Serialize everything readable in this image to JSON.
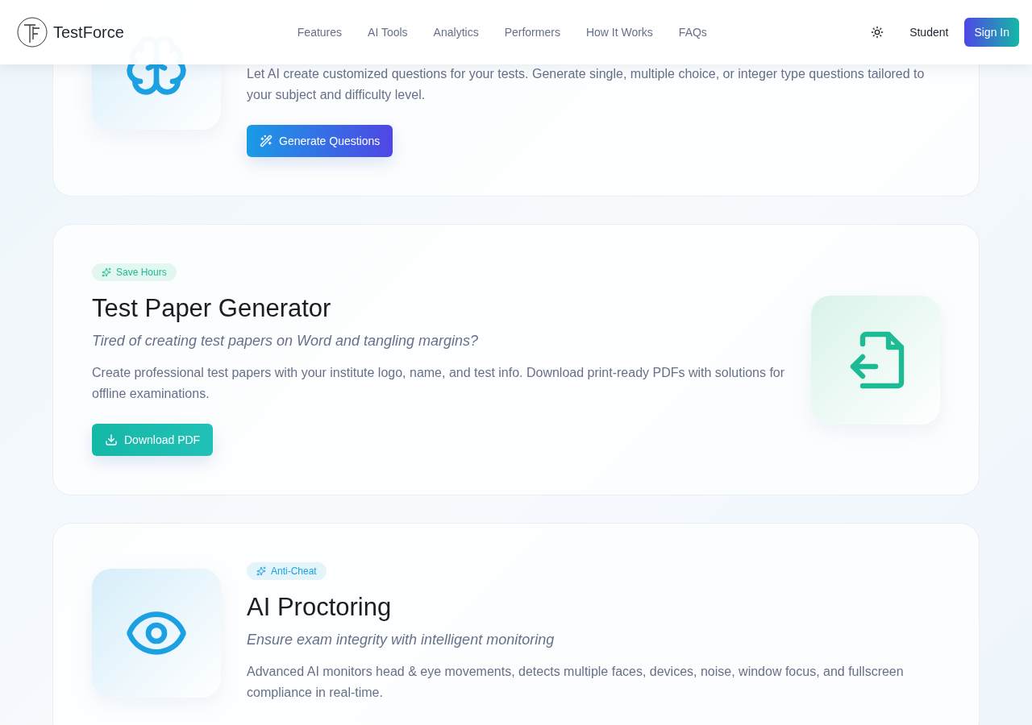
{
  "header": {
    "brand": "TestForce",
    "nav": [
      {
        "label": "Features"
      },
      {
        "label": "AI Tools"
      },
      {
        "label": "Analytics"
      },
      {
        "label": "Performers"
      },
      {
        "label": "How It Works"
      },
      {
        "label": "FAQs"
      }
    ],
    "role_link": "Student",
    "sign_in": "Sign In"
  },
  "features": [
    {
      "kind": "icon-left",
      "description": "Let AI create customized questions for your tests. Generate single, multiple choice, or integer type questions tailored to your subject and difficulty level.",
      "button": "Generate Questions"
    },
    {
      "kind": "icon-right",
      "badge": "Save Hours",
      "title": "Test Paper Generator",
      "subtitle": "Tired of creating test papers on Word and tangling margins?",
      "description": "Create professional test papers with your institute logo, name, and test info. Download print-ready PDFs with solutions for offline examinations.",
      "button": "Download PDF"
    },
    {
      "kind": "icon-left",
      "badge": "Anti-Cheat",
      "title": "AI Proctoring",
      "subtitle": "Ensure exam integrity with intelligent monitoring",
      "description": "Advanced AI monitors head & eye movements, detects multiple faces, devices, noise, window focus, and fullscreen compliance in real-time."
    }
  ]
}
